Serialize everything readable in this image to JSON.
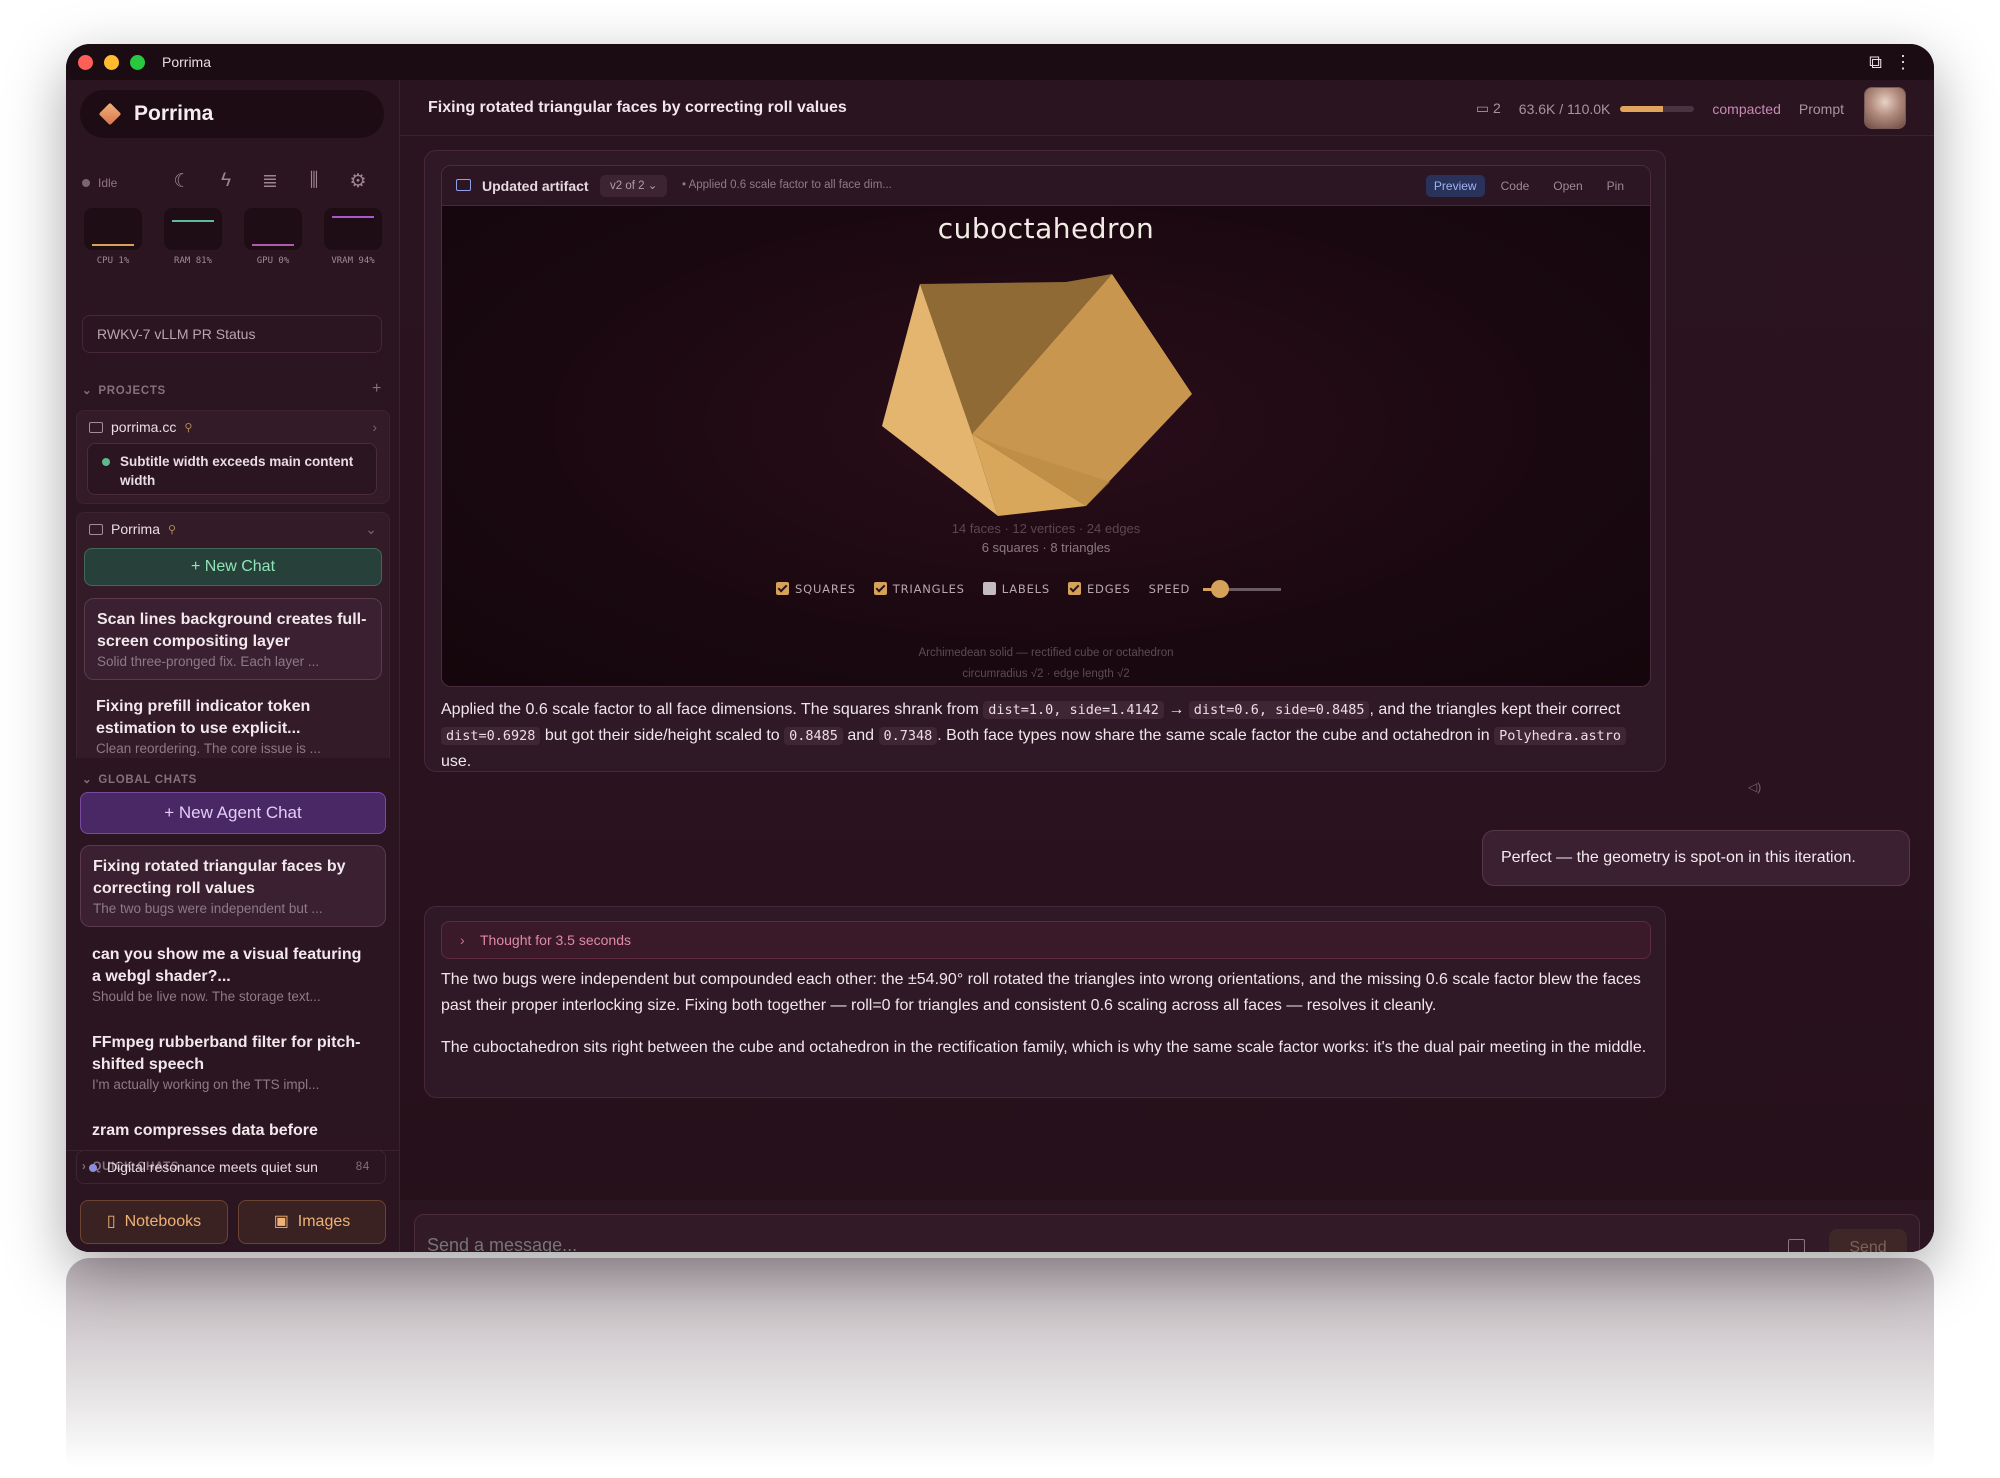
{
  "window": {
    "title": "Porrima"
  },
  "sidebar": {
    "brand": "Porrima",
    "status": "Idle",
    "meters": [
      {
        "label": "CPU 1%",
        "value": 1,
        "color": "#d6a25a"
      },
      {
        "label": "RAM 81%",
        "value": 81,
        "color": "#5fb8a0"
      },
      {
        "label": "GPU 0%",
        "value": 0,
        "color": "#b05aa8"
      },
      {
        "label": "VRAM 94%",
        "value": 94,
        "color": "#a65acb"
      }
    ],
    "pr_status": "RWKV-7 vLLM PR Status",
    "projects_label": "PROJECTS",
    "projects": [
      {
        "name": "porrima.cc",
        "items": [
          "Subtitle width exceeds main content width"
        ]
      },
      {
        "name": "Porrima"
      }
    ],
    "new_chat_label": "+ New Chat",
    "project_chats": [
      {
        "title": "Scan lines background creates full-screen compositing layer",
        "preview": "Solid three-pronged fix. Each layer ..."
      },
      {
        "title": "Fixing prefill indicator token estimation to use explicit...",
        "preview": "Clean reordering. The core issue is ..."
      }
    ],
    "global_label": "GLOBAL CHATS",
    "new_agent_label": "+ New Agent Chat",
    "global_chats": [
      {
        "title": "Fixing rotated triangular faces by correcting roll values",
        "preview": "The two bugs were independent but ..."
      },
      {
        "title": "can you show me a visual featuring a webgl shader?...",
        "preview": "Should be live now. The storage text..."
      },
      {
        "title": "FFmpeg rubberband filter for pitch-shifted speech",
        "preview": "I'm actually working on the TTS impl..."
      },
      {
        "title": "zram compresses data before",
        "preview": ""
      }
    ],
    "quick_label": "QUICK CHATS",
    "quick_count": "84",
    "quick_item": "Digital resonance meets quiet sun",
    "notebooks_label": "Notebooks",
    "images_label": "Images"
  },
  "header": {
    "title": "Fixing rotated triangular faces by correcting roll values",
    "folder_count": "2",
    "tokens": "63.6K / 110.0K",
    "token_fraction": 0.578,
    "compacted": "compacted",
    "prompt": "Prompt"
  },
  "artifact": {
    "label": "Updated artifact",
    "version": "v2 of 2",
    "desc": "• Applied 0.6 scale factor to all face dim...",
    "tabs": [
      "Preview",
      "Code",
      "Open",
      "Pin"
    ],
    "poly_name": "cuboctahedron",
    "stats": "14 faces · 12 vertices · 24 edges",
    "faces": "6 squares · 8 triangles",
    "controls": [
      "SQUARES",
      "TRIANGLES",
      "LABELS",
      "EDGES",
      "SPEED"
    ],
    "speed": 0.22,
    "caption1": "Archimedean solid — rectified cube or octahedron",
    "caption2": "circumradius √2 · edge length √2",
    "colors": {
      "face_light": "#e3b56e",
      "face_mid": "#c9964f",
      "face_dark": "#8f6a35"
    }
  },
  "message1": {
    "p_a": "Applied the 0.6 scale factor to all face dimensions. The squares shrank from ",
    "c1": "dist=1.0, side=1.4142",
    "p_b": " → ",
    "c2": "dist=0.6, side=0.8485",
    "p_c": ", and the triangles kept their correct ",
    "c3": "dist=0.6928",
    "p_d": " but got their side/height scaled to ",
    "c4": "0.8485",
    "p_e": " and ",
    "c5": "0.7348",
    "p_f": ". Both face types now share the same scale factor the cube and octahedron in ",
    "c6": "Polyhedra.astro",
    "p_g": " use."
  },
  "user_message": "Perfect — the geometry is spot-on in this iteration.",
  "message2": {
    "thought": "Thought for 3.5 seconds",
    "p1": "The two bugs were independent but compounded each other: the ±54.90° roll rotated the triangles into wrong orientations, and the missing 0.6 scale factor blew the faces past their proper interlocking size. Fixing both together — roll=0 for triangles and consistent 0.6 scaling across all faces — resolves it cleanly.",
    "p2": "The cuboctahedron sits right between the cube and octahedron in the rectification family, which is why the same scale factor works: it's the dual pair meeting in the middle."
  },
  "composer": {
    "placeholder": "Send a message...",
    "send": "Send"
  }
}
